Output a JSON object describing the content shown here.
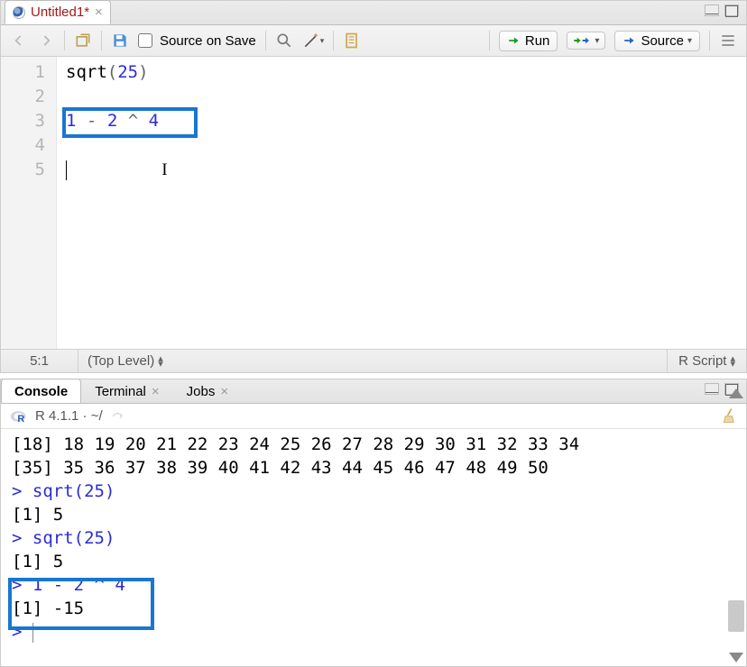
{
  "editor": {
    "tab": {
      "title": "Untitled1*"
    },
    "toolbar": {
      "source_on_save_label": "Source on Save",
      "run_label": "Run",
      "source_btn_label": "Source"
    },
    "gutter": [
      "1",
      "2",
      "3",
      "4",
      "5"
    ],
    "code": {
      "l1_fn": "sqrt",
      "l1_open": "(",
      "l1_num": "25",
      "l1_close": ")",
      "l3_n1": "1",
      "l3_op1": "-",
      "l3_n2": "2",
      "l3_op2": "^",
      "l3_n3": "4"
    },
    "status": {
      "pos": "5:1",
      "scope": "(Top Level)",
      "lang": "R Script"
    }
  },
  "console": {
    "tabs": {
      "console": "Console",
      "terminal": "Terminal",
      "jobs": "Jobs"
    },
    "info": "R 4.1.1 · ~/",
    "lines": {
      "l1": "[18] 18 19 20 21 22 23 24 25 26 27 28 29 30 31 32 33 34",
      "l2": "[35] 35 36 37 38 39 40 41 42 43 44 45 46 47 48 49 50",
      "l3": "> sqrt(25)",
      "l4": "[1] 5",
      "l5": "> sqrt(25)",
      "l6": "[1] 5",
      "l7": "> 1 - 2 ^ 4",
      "l8": "[1] -15",
      "l9": "> "
    }
  }
}
